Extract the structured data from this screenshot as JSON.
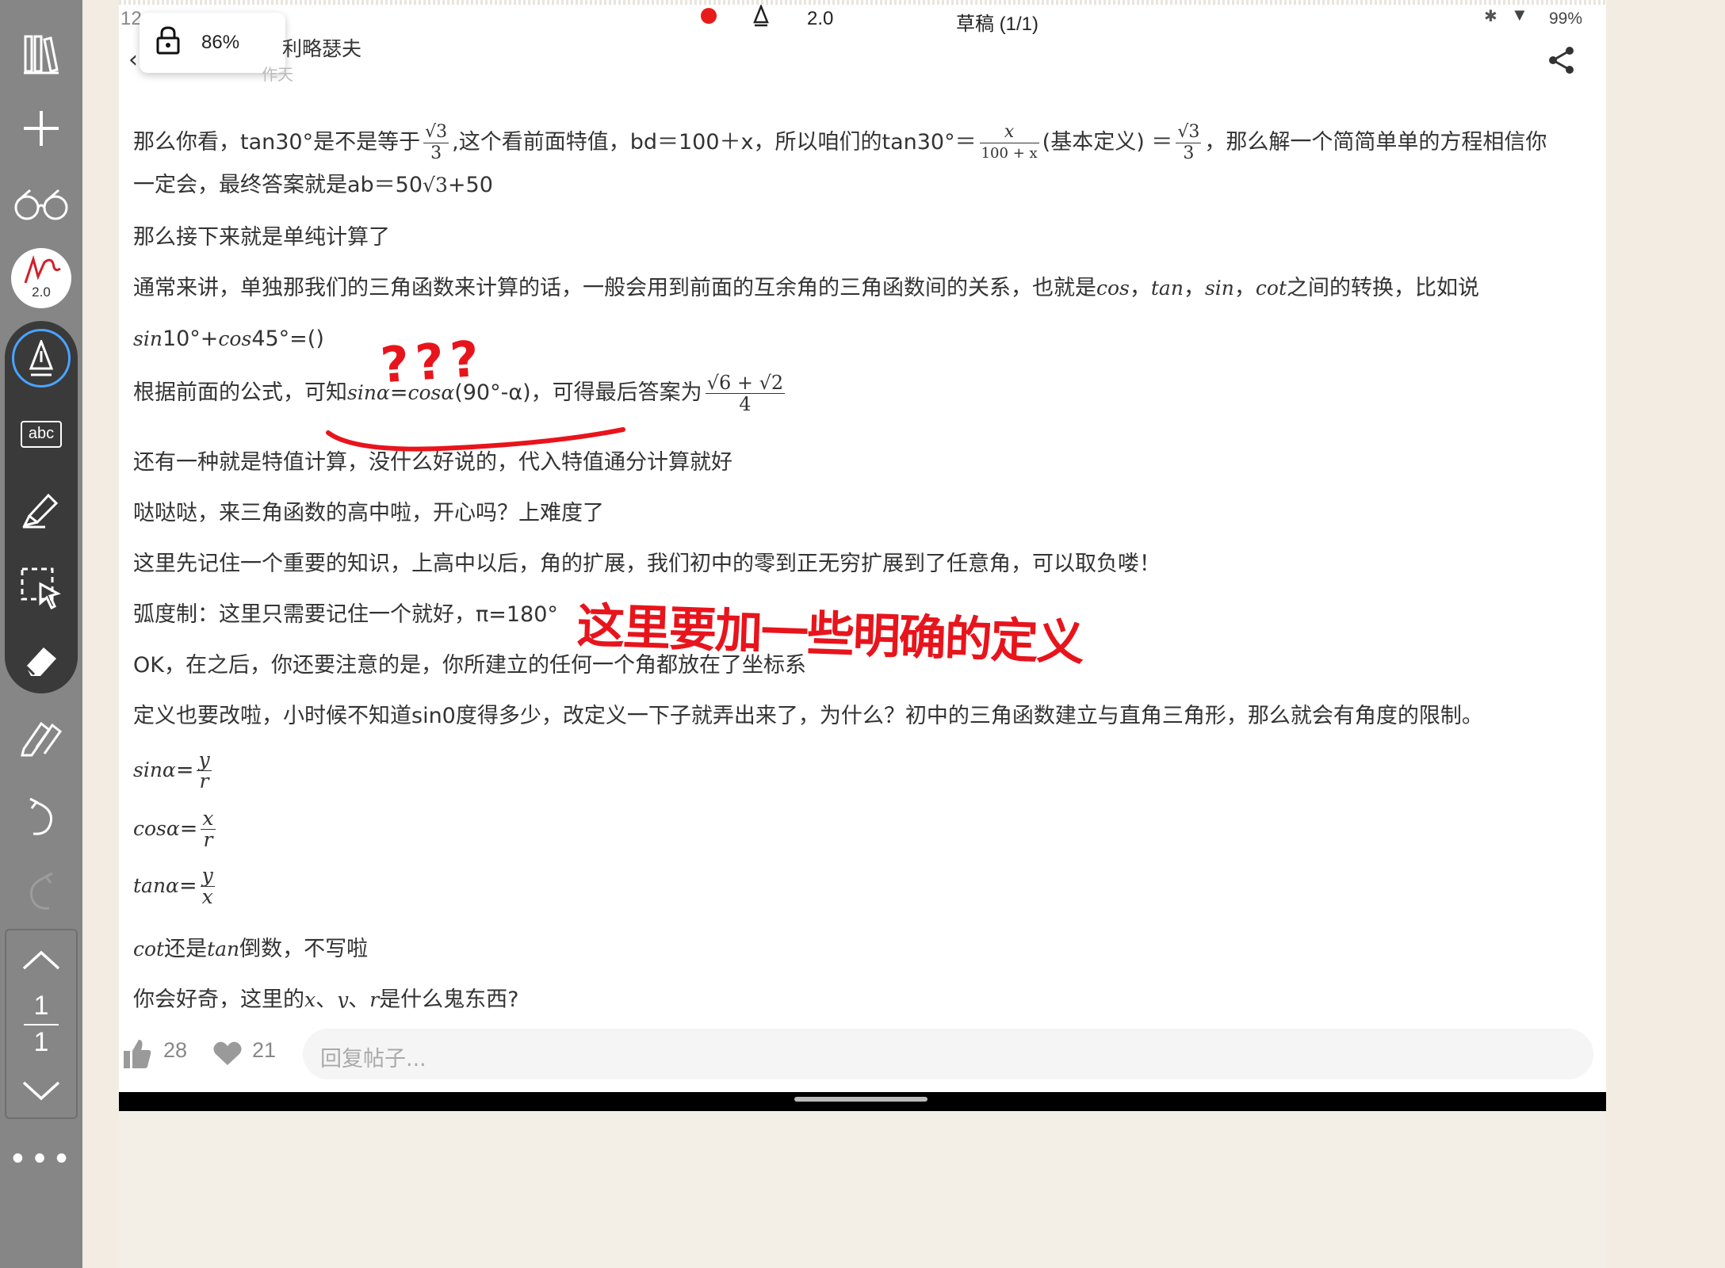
{
  "toolbar": {
    "pen_size_badge": "2.0",
    "page_current": "1",
    "page_total": "1",
    "more": "•••"
  },
  "status_bar": {
    "time": "12:",
    "pen_size": "2.0",
    "doc_title": "草稿 (1/1)",
    "battery": "99%",
    "record_color": "#e81b1b"
  },
  "lock_popup": {
    "zoom": "86%"
  },
  "post": {
    "author": "利略瑟夫",
    "sub": "作天",
    "lines": [
      {
        "a": "那么你看，tan30°是不是等于",
        "f1n": "√3",
        "f1d": "3",
        "b": ",这个看前面特值，bd＝100＋x，所以咱们的tan30°＝",
        "f2n": "x",
        "f2d": "100 + x",
        "c": "(基本定义) ＝",
        "f3n": "√3",
        "f3d": "3",
        "d": "，那么解一个简简单单的方程相信你"
      },
      {
        "a": "一定会，最终答案就是ab＝50",
        "m": "√3",
        "b": "+50"
      },
      {
        "a": "那么接下来就是单纯计算了"
      },
      {
        "a": "通常来讲，单独那我们的三角函数来计算的话，一般会用到前面的互余角的三角函数间的关系，也就是",
        "m1": "cos",
        "s1": "，",
        "m2": "tan",
        "s2": "，",
        "m3": "sin",
        "s3": "，",
        "m4": "cot",
        "b": "之间的转换，比如说"
      },
      {
        "m1": "sin",
        "a": "10°+",
        "m2": "cos",
        "b": "45°=()"
      },
      {
        "a": "根据前面的公式，可知",
        "m1": "sinα",
        "s1": "=",
        "m2": "cosα",
        "b": "(90°-α)，可得最后答案为",
        "fn": "√6 + √2",
        "fd": "4"
      },
      {
        "a": "还有一种就是特值计算，没什么好说的，代入特值通分计算就好"
      },
      {
        "a": "哒哒哒，来三角函数的高中啦，开心吗？上难度了"
      },
      {
        "a": "这里先记住一个重要的知识，上高中以后，角的扩展，我们初中的零到正无穷扩展到了任意角，可以取负喽！"
      },
      {
        "a": "弧度制：这里只需要记住一个就好，π=180°"
      },
      {
        "a": "OK，在之后，你还要注意的是，你所建立的任何一个角都放在了坐标系"
      },
      {
        "a": "定义也要改啦，小时候不知道sin0度得多少，改定义一下子就弄出来了，为什么？初中的三角函数建立与直角三角形，那么就会有角度的限制。"
      },
      {
        "m": "sinα",
        "s": "=",
        "fn": "y",
        "fd": "r"
      },
      {
        "m": "cosα",
        "s": "=",
        "fn": "x",
        "fd": "r"
      },
      {
        "m": "tanα",
        "s": "=",
        "fn": "y",
        "fd": "x"
      },
      {
        "m1": "cot",
        "a": "还是",
        "m2": "tan",
        "b": "倒数，不写啦"
      },
      {
        "a": "你会好奇，这里的",
        "m1": "x",
        "s1": "、",
        "m2": "y",
        "s2": "、",
        "m3": "r",
        "b": "是什么鬼东西?"
      }
    ]
  },
  "annotations": {
    "question": "???",
    "note": "这里要加一些明确的定义",
    "ink_color": "#e8141c"
  },
  "bottom": {
    "likes": "28",
    "favs": "21",
    "reply_placeholder": "回复帖子..."
  }
}
